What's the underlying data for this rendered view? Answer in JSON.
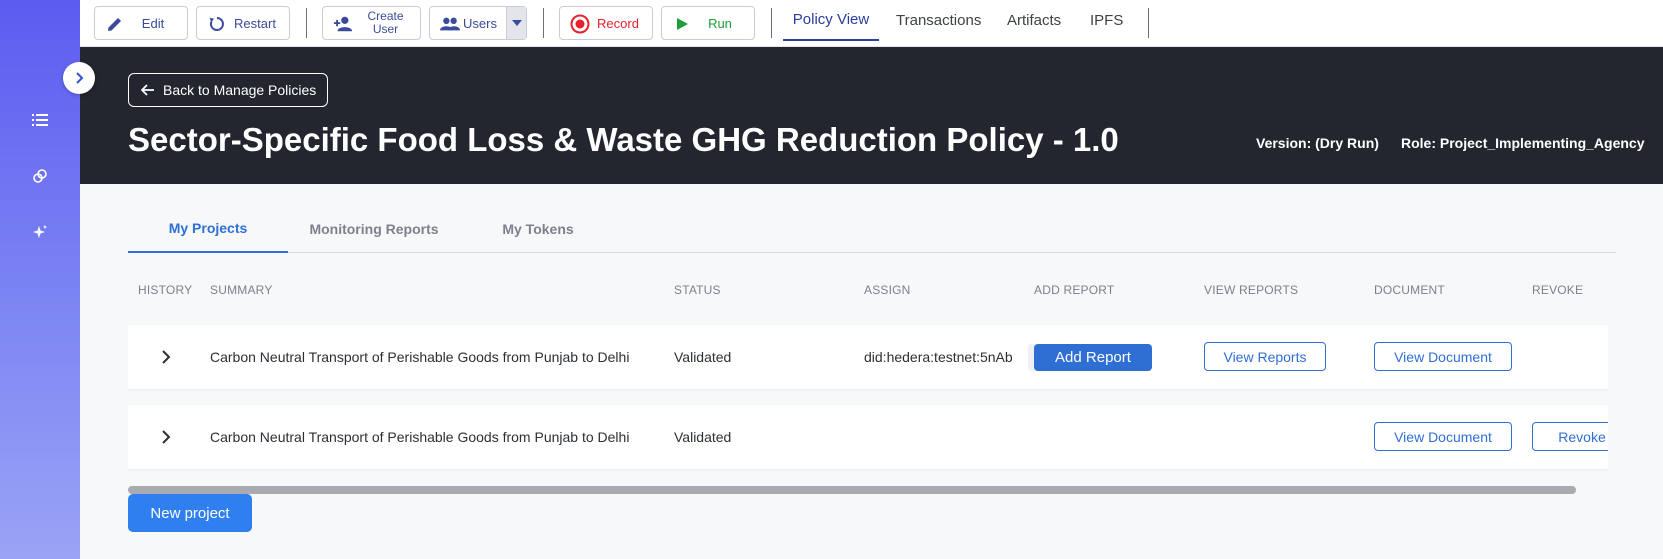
{
  "toolbar": {
    "edit_label": "Edit",
    "restart_label": "Restart",
    "create_user_label": "Create User",
    "users_label": "Users",
    "record_label": "Record",
    "run_label": "Run",
    "nav_tabs": [
      {
        "label": "Policy View",
        "active": true
      },
      {
        "label": "Transactions",
        "active": false
      },
      {
        "label": "Artifacts",
        "active": false
      },
      {
        "label": "IPFS",
        "active": false
      }
    ]
  },
  "sidebar": {
    "icons": [
      "list-icon",
      "link-icon",
      "sparkle-icon"
    ],
    "expand_icon": "chevron-right-icon"
  },
  "header": {
    "back_label": "Back to Manage Policies",
    "title": "Sector-Specific Food Loss & Waste GHG Reduction Policy - 1.0",
    "version": "Version: (Dry Run)",
    "role": "Role: Project_Implementing_Agency"
  },
  "content_tabs": [
    {
      "label": "My Projects",
      "active": true
    },
    {
      "label": "Monitoring Reports",
      "active": false
    },
    {
      "label": "My Tokens",
      "active": false
    }
  ],
  "table": {
    "columns": [
      "HISTORY",
      "SUMMARY",
      "STATUS",
      "ASSIGN",
      "ADD REPORT",
      "VIEW REPORTS",
      "DOCUMENT",
      "REVOKE"
    ],
    "rows": [
      {
        "summary": "Carbon Neutral Transport of Perishable Goods from Punjab to Delhi",
        "status": "Validated",
        "assign": "did:hedera:testnet:5nAb",
        "add_report": "Add Report",
        "view_reports": "View Reports",
        "document": "View Document",
        "revoke": ""
      },
      {
        "summary": "Carbon Neutral Transport of Perishable Goods from Punjab to Delhi",
        "status": "Validated",
        "assign": "",
        "add_report": "",
        "view_reports": "",
        "document": "View Document",
        "revoke": "Revoke"
      }
    ]
  },
  "new_project_label": "New project",
  "colors": {
    "accent": "#2f6fd4",
    "header_bg": "#23252f",
    "record_red": "#e8202a",
    "run_green": "#1f9d3a",
    "sidebar_top": "#5b5cf0"
  }
}
